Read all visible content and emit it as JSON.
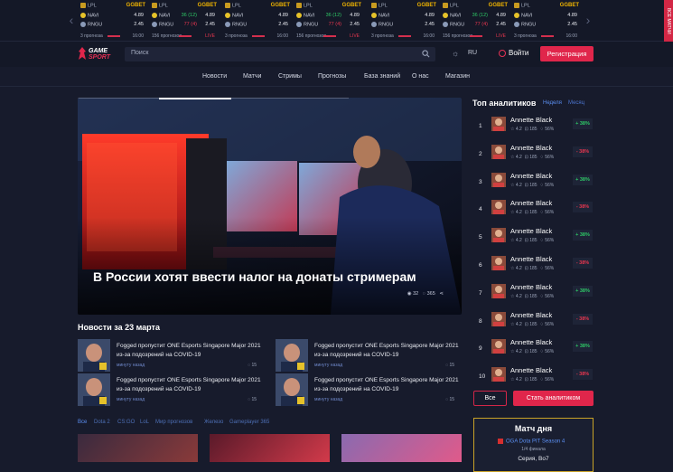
{
  "colors": {
    "accent": "#e0264b",
    "bg": "#171b2c",
    "panel": "#141827",
    "link": "#5b8ff2",
    "gold": "#c9a227",
    "green": "#2ec866",
    "red": "#e8364f"
  },
  "ticker": {
    "matches": [
      {
        "league": "LPL",
        "book": "GGBET",
        "team1": "NAVI",
        "team2": "RNGU",
        "score1": "",
        "score2": "",
        "odd1": "4.89",
        "odd2": "2.45",
        "forecasts": "3 прогноза",
        "status": "16:00",
        "live": false
      },
      {
        "league": "LPL",
        "book": "GGBET",
        "team1": "NAVI",
        "team2": "RNGU",
        "score1": "36 (12)",
        "score2": "77 (4)",
        "odd1": "4.89",
        "odd2": "2.45",
        "forecasts": "156 прогнозов",
        "status": "LIVE",
        "live": true
      },
      {
        "league": "LPL",
        "book": "GGBET",
        "team1": "NAVI",
        "team2": "RNGU",
        "score1": "",
        "score2": "",
        "odd1": "4.89",
        "odd2": "2.45",
        "forecasts": "3 прогноза",
        "status": "16:00",
        "live": false
      },
      {
        "league": "LPL",
        "book": "GGBET",
        "team1": "NAVI",
        "team2": "RNGU",
        "score1": "36 (12)",
        "score2": "77 (4)",
        "odd1": "4.89",
        "odd2": "2.45",
        "forecasts": "156 прогнозов",
        "status": "LIVE",
        "live": true
      },
      {
        "league": "LPL",
        "book": "GGBET",
        "team1": "NAVI",
        "team2": "RNGU",
        "score1": "",
        "score2": "",
        "odd1": "4.89",
        "odd2": "2.45",
        "forecasts": "3 прогноза",
        "status": "16:00",
        "live": false
      },
      {
        "league": "LPL",
        "book": "GGBET",
        "team1": "NAVI",
        "team2": "RNGU",
        "score1": "36 (12)",
        "score2": "77 (4)",
        "odd1": "4.89",
        "odd2": "2.45",
        "forecasts": "156 прогнозов",
        "status": "LIVE",
        "live": true
      },
      {
        "league": "LPL",
        "book": "GGBET",
        "team1": "NAVI",
        "team2": "RNGU",
        "score1": "",
        "score2": "",
        "odd1": "4.89",
        "odd2": "2.45",
        "forecasts": "3 прогноза",
        "status": "16:00",
        "live": false
      }
    ],
    "side_label": "ВСЕ МАТЧИ"
  },
  "header": {
    "logo_line1": "GAME",
    "logo_line2": "SPORT",
    "search_placeholder": "Поиск",
    "lang": "RU",
    "login": "Войти",
    "register": "Регистрация"
  },
  "nav": [
    "Новости",
    "Матчи",
    "Стримы",
    "Прогнозы",
    "База знаний",
    "О нас",
    "Магазин"
  ],
  "hero": {
    "title": "В России хотят ввести налог на донаты стримерам",
    "views": "32",
    "comments": "365"
  },
  "news": {
    "title": "Новости за 23 марта",
    "items": [
      {
        "text": "Fogged пропустит ONE Esports Singapore Major 2021 из-за подозрений на COVID-19",
        "time": "минуту назад",
        "comments": "15"
      },
      {
        "text": "Fogged пропустит ONE Esports Singapore Major 2021 из-за подозрений на COVID-19",
        "time": "минуту назад",
        "comments": "15"
      },
      {
        "text": "Fogged пропустит ONE Esports Singapore Major 2021 из-за подозрений на COVID-19",
        "time": "минуту назад",
        "comments": "15"
      },
      {
        "text": "Fogged пропустит ONE Esports Singapore Major 2021 из-за подозрений на COVID-19",
        "time": "минуту назад",
        "comments": "15"
      }
    ]
  },
  "tabs": [
    "Все",
    "Dota 2",
    "CS:GO",
    "LoL",
    "Мир прогнозов",
    "Железо",
    "Gameplayer 365"
  ],
  "top": {
    "title": "Топ аналитиков",
    "tab1": "Неделя",
    "tab2": "Месяц",
    "items": [
      {
        "rank": "1",
        "name": "Annette Black",
        "rating": "4.2",
        "bets": "185",
        "win": "56%",
        "badge": "+ 38%",
        "pos": true
      },
      {
        "rank": "2",
        "name": "Annette Black",
        "rating": "4.2",
        "bets": "185",
        "win": "56%",
        "badge": "- 38%",
        "pos": false
      },
      {
        "rank": "3",
        "name": "Annette Black",
        "rating": "4.2",
        "bets": "185",
        "win": "56%",
        "badge": "+ 38%",
        "pos": true
      },
      {
        "rank": "4",
        "name": "Annette Black",
        "rating": "4.2",
        "bets": "185",
        "win": "56%",
        "badge": "- 38%",
        "pos": false
      },
      {
        "rank": "5",
        "name": "Annette Black",
        "rating": "4.2",
        "bets": "185",
        "win": "56%",
        "badge": "+ 38%",
        "pos": true
      },
      {
        "rank": "6",
        "name": "Annette Black",
        "rating": "4.2",
        "bets": "185",
        "win": "56%",
        "badge": "- 38%",
        "pos": false
      },
      {
        "rank": "7",
        "name": "Annette Black",
        "rating": "4.2",
        "bets": "185",
        "win": "56%",
        "badge": "+ 38%",
        "pos": true
      },
      {
        "rank": "8",
        "name": "Annette Black",
        "rating": "4.2",
        "bets": "185",
        "win": "56%",
        "badge": "- 38%",
        "pos": false
      },
      {
        "rank": "9",
        "name": "Annette Black",
        "rating": "4.2",
        "bets": "185",
        "win": "56%",
        "badge": "+ 38%",
        "pos": true
      },
      {
        "rank": "10",
        "name": "Annette Black",
        "rating": "4.2",
        "bets": "185",
        "win": "56%",
        "badge": "- 38%",
        "pos": false
      }
    ],
    "btn_all": "Все",
    "btn_become": "Стать аналитиком"
  },
  "match_day": {
    "title": "Матч дня",
    "tournament": "OGA Dota PIT Season 4",
    "subtitle": "1/4 финала",
    "format": "Серия, Bo7"
  }
}
